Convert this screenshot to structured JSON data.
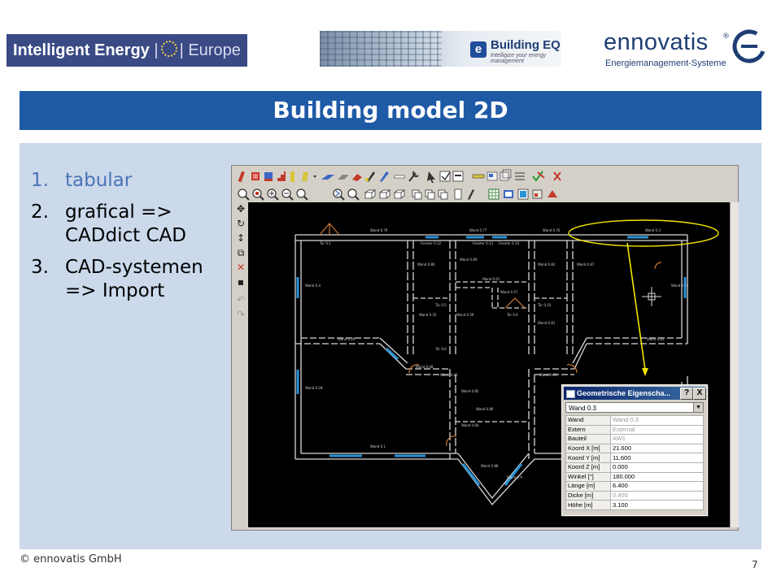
{
  "logos": {
    "intelligent_energy": {
      "main": "Intelligent Energy",
      "eu": "Europe"
    },
    "building_eq": {
      "badge": "e",
      "title": "Building EQ",
      "tagline": "Intelligize your energy management"
    },
    "ennovatis": {
      "wordmark": "ennovatis",
      "registered": "®",
      "subtitle": "Energiemanagement-Systeme",
      "brand_color": "#1f3d75"
    }
  },
  "slide": {
    "title": "Building model 2D",
    "title_bg": "#1f5aa6",
    "content_bg": "#cbd9eb",
    "bullets": [
      {
        "num": "1.",
        "text": "tabular",
        "style": "muted"
      },
      {
        "num": "2.",
        "text": "grafical => CADdict CAD",
        "style": "normal"
      },
      {
        "num": "3.",
        "text": "CAD-systemen => Import",
        "style": "normal"
      }
    ],
    "footer": {
      "copyright": "© ennovatis GmbH",
      "page_number": "7"
    }
  },
  "cad_window": {
    "toolbar_row1_icons": [
      "wall-tool-icon",
      "window-tool-icon",
      "door-tool-icon",
      "stair-tool-icon",
      "column-tool-icon",
      "roof-tool-icon",
      "floor-tool-icon",
      "erase-tool-icon",
      "pen-tool-icon",
      "pencil-tool-icon",
      "line-tool-icon",
      "wrench-tool-icon",
      "select-tool-icon",
      "check-tool-icon",
      "properties-tool-icon",
      "measure-tool-icon",
      "layer-tool-icon",
      "copy-tool-icon",
      "move-tool-icon",
      "check-mark-icon",
      "delete-x-icon"
    ],
    "toolbar_row2_icons": [
      "zoom-window-icon",
      "zoom-all-icon",
      "zoom-in-icon",
      "zoom-out-icon",
      "zoom-prev-icon",
      "zoom-next-icon",
      "pan-icon",
      "zoom-extent-icon",
      "view-front-icon",
      "view-back-icon",
      "view-side-icon",
      "view-top-icon",
      "copy-icon",
      "paste-icon",
      "group-icon",
      "page-icon",
      "edit-icon",
      "grid-icon",
      "layer-icon",
      "snap-icon",
      "3d-view-icon",
      "arrow-up-icon"
    ],
    "side_tools": [
      "move-cross-icon",
      "rotate-icon",
      "scale-icon",
      "mirror-icon",
      "delete-icon",
      "point-icon",
      "undo-icon",
      "redo-icon"
    ],
    "drawing": {
      "background": "#000000",
      "wall_color": "#d8d8d8",
      "window_color": "#2a93d8",
      "door_color": "#c87a3a",
      "highlight_color": "#f2e600",
      "labels": {
        "wand_0_79": "Wand 0.79",
        "wand_0_77": "Wand 0.77",
        "wand_0_76": "Wand 0.76",
        "wand_0_3": "Wand 0.3",
        "wand_0_80": "Wand 0.80",
        "wand_0_69": "Wand 0.69",
        "wand_0_82": "Wand 0.82",
        "wand_0_87": "Wand 0.87",
        "wand_0_61": "Wand 0.61",
        "wand_0_57": "Wand 0.57",
        "wand_0_74": "Wand 0.74",
        "wand_0_4": "Wand 0.4",
        "wand_0_35": "Wand 0.35",
        "wand_0_59": "Wand 0.59",
        "wand_0_81": "Wand 0.81",
        "wand_0_29": "Wand 0.29",
        "wand_0_48": "Wand 0.48",
        "wand_0_42": "Wand 0.42",
        "wand_0_43": "Wand 0.43",
        "wand_0_85": "Wand 0.85",
        "wand_0_86": "Wand 0.86",
        "wand_0_84": "Wand 0.84",
        "wand_0_1": "Wand 0.1",
        "wand_0_28": "Wand 0.28",
        "wand_0_88": "Wand 0.88",
        "wand_0_9": "Wand 0.9",
        "fenster_0_12": "Fenster 0.12",
        "fenster_0_13": "Fenster 0.13",
        "fenster_0_14": "Fenster 0.14",
        "tuer_0_1": "Tür 0.1",
        "tuer_0_5": "Tür 0.5",
        "tuer_0_6": "Tür 0.6",
        "tuer_0_10": "Tür 0.10",
        "tuer_0_4": "Tür 0.4"
      }
    }
  },
  "properties_dialog": {
    "title": "Geometrische Eigenscha...",
    "help_label": "?",
    "close_label": "X",
    "selected": "Wand 0.3",
    "rows": [
      {
        "key": "Wand",
        "value": "Wand 0.3",
        "editable": false
      },
      {
        "key": "Extern",
        "value": "External",
        "editable": false
      },
      {
        "key": "Bauteil",
        "value": "AW1",
        "editable": false
      },
      {
        "key": "Koord X [m]",
        "value": "21.600",
        "editable": true
      },
      {
        "key": "Koord Y [m]",
        "value": "11.600",
        "editable": true
      },
      {
        "key": "Koord Z [m]",
        "value": "0.000",
        "editable": true
      },
      {
        "key": "Winkel [°]",
        "value": "180.000",
        "editable": true
      },
      {
        "key": "Länge [m]",
        "value": "6.400",
        "editable": true
      },
      {
        "key": "Dicke [m]",
        "value": "0.400",
        "editable": false
      },
      {
        "key": "Höhe [m]",
        "value": "3.100",
        "editable": true
      }
    ]
  }
}
